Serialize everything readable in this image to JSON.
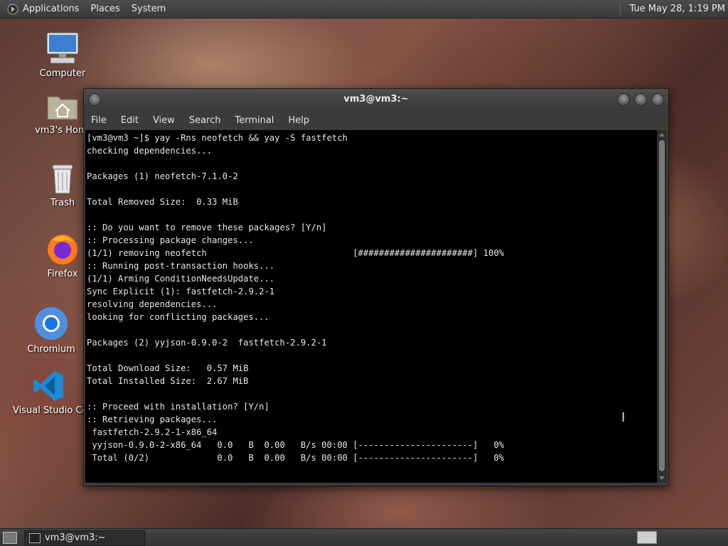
{
  "top_panel": {
    "menus": [
      "Applications",
      "Places",
      "System"
    ],
    "clock": "Tue May 28, 1:19 PM"
  },
  "desktop": {
    "icons": [
      {
        "label": "Computer",
        "icon": "computer-icon"
      },
      {
        "label": "vm3's Home",
        "icon": "home-folder-icon"
      },
      {
        "label": "Trash",
        "icon": "trash-icon"
      },
      {
        "label": "Firefox",
        "icon": "firefox-icon"
      },
      {
        "label": "Chromium",
        "icon": "chromium-icon"
      },
      {
        "label": "Visual Studio Code",
        "icon": "vscode-icon"
      }
    ]
  },
  "terminal": {
    "title": "vm3@vm3:~",
    "menu": [
      "File",
      "Edit",
      "View",
      "Search",
      "Terminal",
      "Help"
    ],
    "lines": [
      "[vm3@vm3 ~]$ yay -Rns neofetch && yay -S fastfetch",
      "checking dependencies...",
      "",
      "Packages (1) neofetch-7.1.0-2",
      "",
      "Total Removed Size:  0.33 MiB",
      "",
      ":: Do you want to remove these packages? [Y/n]",
      ":: Processing package changes...",
      "(1/1) removing neofetch                            [######################] 100%",
      ":: Running post-transaction hooks...",
      "(1/1) Arming ConditionNeedsUpdate...",
      "Sync Explicit (1): fastfetch-2.9.2-1",
      "resolving dependencies...",
      "looking for conflicting packages...",
      "",
      "Packages (2) yyjson-0.9.0-2  fastfetch-2.9.2-1",
      "",
      "Total Download Size:   0.57 MiB",
      "Total Installed Size:  2.67 MiB",
      "",
      ":: Proceed with installation? [Y/n]",
      ":: Retrieving packages...",
      " fastfetch-2.9.2-1-x86_64",
      " yyjson-0.9.0-2-x86_64   0.0   B  0.00   B/s 00:00 [----------------------]   0%",
      " Total (0/2)             0.0   B  0.00   B/s 00:00 [----------------------]   0%"
    ]
  },
  "taskbar": {
    "window_button": "vm3@vm3:~"
  }
}
